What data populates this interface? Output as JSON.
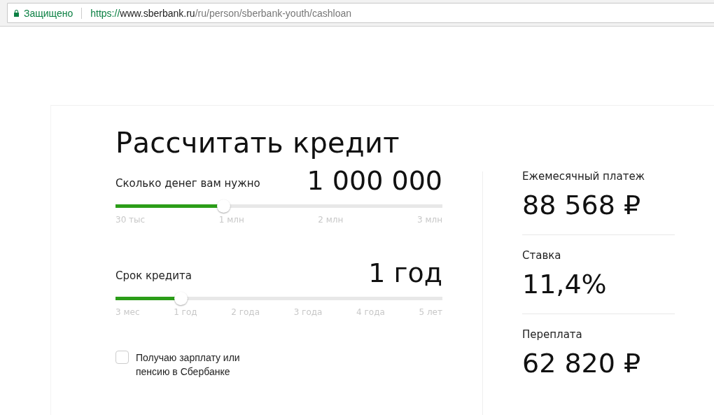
{
  "address_bar": {
    "secure_label": "Защищено",
    "url_scheme": "https://",
    "url_host": "www.sberbank.ru",
    "url_path": "/ru/person/sberbank-youth/cashloan"
  },
  "calculator": {
    "title": "Рассчитать кредит",
    "sliders": [
      {
        "label": "Сколько денег вам нужно",
        "value": "1 000 000",
        "level": 0.33,
        "ticks": [
          "30 тыс",
          "1 млн",
          "2 млн",
          "3 млн"
        ]
      },
      {
        "label": "Срок кредита",
        "value": "1 год",
        "level": 0.2,
        "ticks": [
          "3 мес",
          "1 год",
          "2 года",
          "3 года",
          "4 года",
          "5 лет"
        ]
      }
    ],
    "salary_checkbox": {
      "label": "Получаю зарплату или пенсию в Сбербанке",
      "checked": false
    },
    "results": [
      {
        "label": "Ежемесячный платеж",
        "value": "88 568",
        "currency": "₽"
      },
      {
        "label": "Ставка",
        "value": "11,4%"
      },
      {
        "label": "Переплата",
        "value": "62 820",
        "currency": "₽"
      }
    ]
  }
}
